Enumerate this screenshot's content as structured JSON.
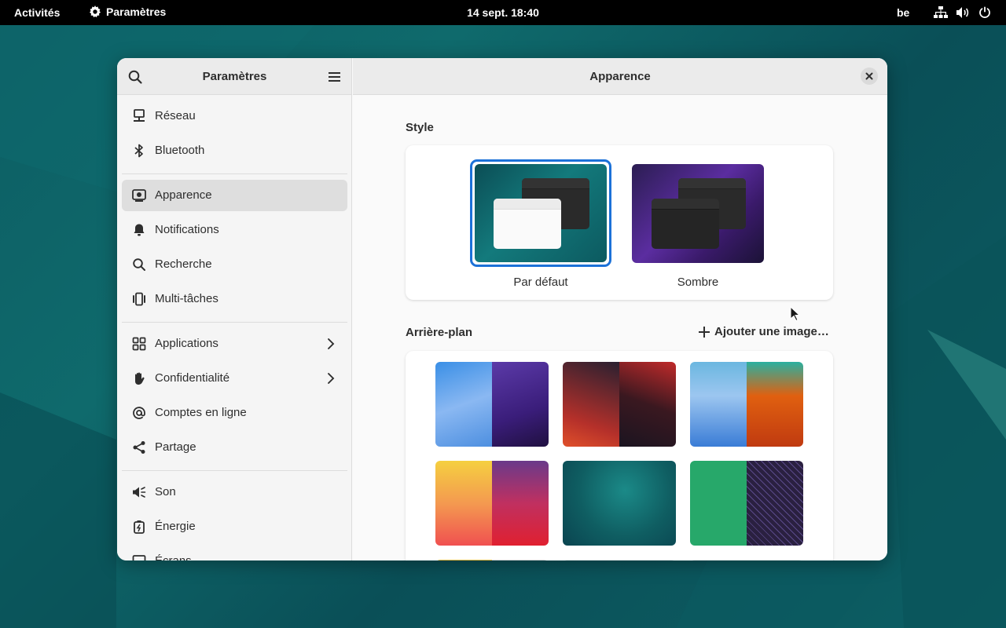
{
  "topbar": {
    "activities": "Activités",
    "app_name": "Paramètres",
    "clock": "14 sept.  18:40",
    "keyboard_layout": "be",
    "status_icons": [
      "network-icon",
      "volume-icon",
      "power-icon"
    ]
  },
  "sidebar": {
    "title": "Paramètres",
    "items": [
      {
        "label": "Réseau",
        "icon": "network-wired-icon"
      },
      {
        "label": "Bluetooth",
        "icon": "bluetooth-icon"
      },
      {
        "label": "Apparence",
        "icon": "appearance-icon",
        "active": true
      },
      {
        "label": "Notifications",
        "icon": "bell-icon"
      },
      {
        "label": "Recherche",
        "icon": "search-icon"
      },
      {
        "label": "Multi-tâches",
        "icon": "multitasking-icon"
      },
      {
        "label": "Applications",
        "icon": "apps-grid-icon",
        "has_chevron": true
      },
      {
        "label": "Confidentialité",
        "icon": "hand-icon",
        "has_chevron": true
      },
      {
        "label": "Comptes en ligne",
        "icon": "at-icon"
      },
      {
        "label": "Partage",
        "icon": "share-icon"
      },
      {
        "label": "Son",
        "icon": "speaker-icon"
      },
      {
        "label": "Énergie",
        "icon": "battery-icon"
      },
      {
        "label": "Écrans",
        "icon": "display-icon"
      }
    ]
  },
  "content": {
    "title": "Apparence",
    "style_section": {
      "title": "Style",
      "options": [
        {
          "label": "Par défaut",
          "selected": true
        },
        {
          "label": "Sombre",
          "selected": false
        }
      ]
    },
    "background_section": {
      "title": "Arrière-plan",
      "add_button": "Ajouter une image…"
    }
  },
  "colors": {
    "accent": "#3584e4",
    "selection_border": "#1c71d8",
    "desktop": "#0c5d63"
  }
}
